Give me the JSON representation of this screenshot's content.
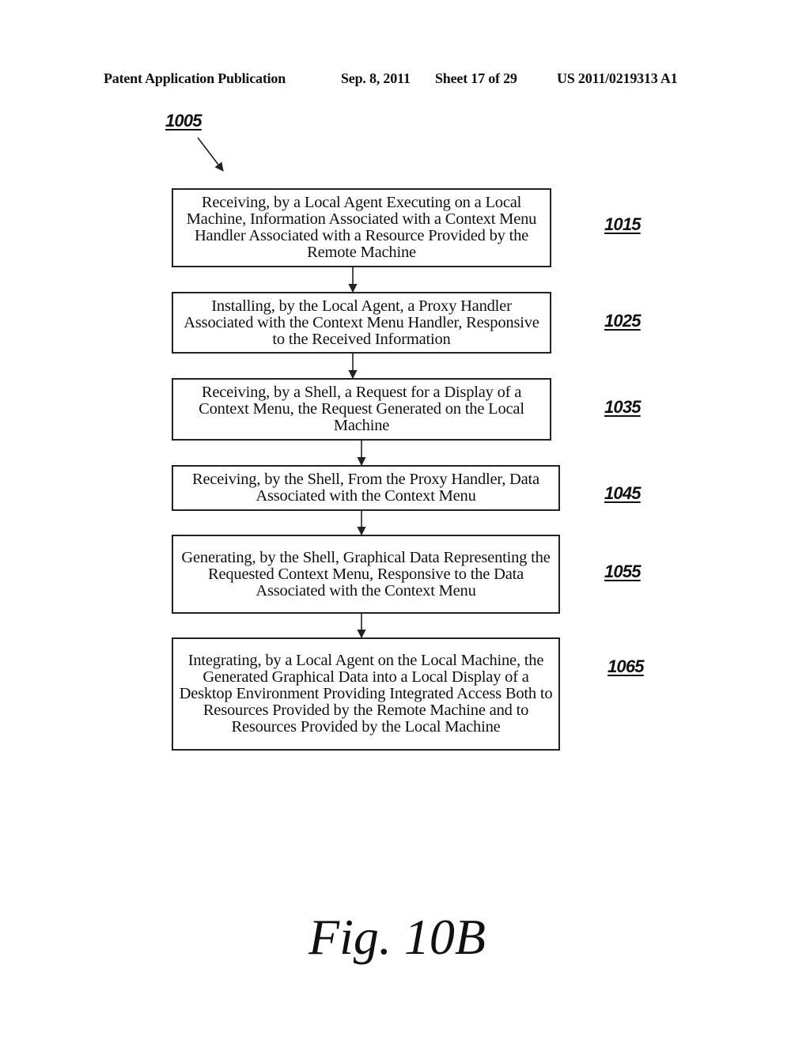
{
  "header": {
    "publication": "Patent Application Publication",
    "date": "Sep. 8, 2011",
    "sheet": "Sheet 17 of 29",
    "patent_number": "US 2011/0219313 A1"
  },
  "diagram": {
    "reference": "1005",
    "steps": [
      {
        "id": "1015",
        "text": "Receiving, by a Local Agent Executing on a Local Machine, Information Associated with a Context Menu Handler Associated with a Resource Provided by the Remote Machine"
      },
      {
        "id": "1025",
        "text": "Installing, by the Local Agent, a Proxy Handler Associated with the Context Menu Handler, Responsive to the Received Information"
      },
      {
        "id": "1035",
        "text": "Receiving, by a Shell, a Request for a Display of a Context Menu, the Request Generated on the Local Machine"
      },
      {
        "id": "1045",
        "text": "Receiving, by the Shell, From the Proxy Handler, Data Associated with the Context Menu"
      },
      {
        "id": "1055",
        "text": "Generating, by the Shell, Graphical Data Representing the Requested Context Menu, Responsive to the Data Associated with the Context Menu"
      },
      {
        "id": "1065",
        "text": "Integrating, by a Local Agent on the Local Machine, the Generated Graphical Data into a Local Display of a Desktop Environment Providing Integrated Access Both to Resources Provided by the Remote Machine and to Resources Provided by the Local Machine"
      }
    ]
  },
  "figure_label": "Fig. 10B"
}
